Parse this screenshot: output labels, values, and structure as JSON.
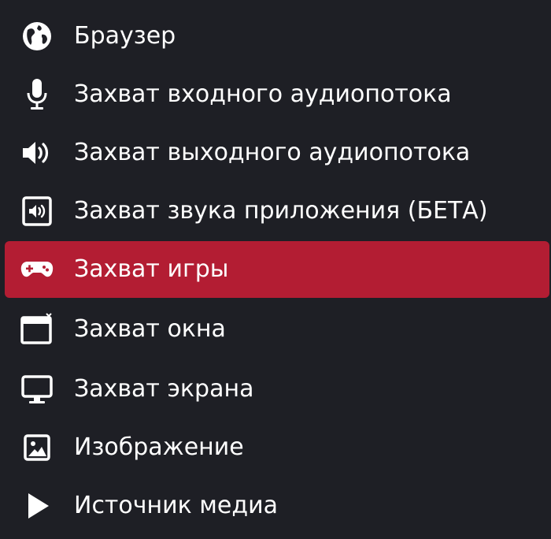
{
  "menu": {
    "items": [
      {
        "label": "Браузер",
        "icon": "globe-icon"
      },
      {
        "label": "Захват входного аудиопотока",
        "icon": "microphone-icon"
      },
      {
        "label": "Захват выходного аудиопотока",
        "icon": "speaker-icon"
      },
      {
        "label": "Захват звука приложения (БЕТА)",
        "icon": "app-audio-icon"
      },
      {
        "label": "Захват игры",
        "icon": "gamepad-icon",
        "selected": true
      },
      {
        "label": "Захват окна",
        "icon": "window-icon"
      },
      {
        "label": "Захват экрана",
        "icon": "monitor-icon"
      },
      {
        "label": "Изображение",
        "icon": "image-icon"
      },
      {
        "label": "Источник медиа",
        "icon": "play-icon"
      }
    ]
  },
  "colors": {
    "background": "#1e1f25",
    "selected": "#b31d33",
    "text": "#ffffff"
  }
}
